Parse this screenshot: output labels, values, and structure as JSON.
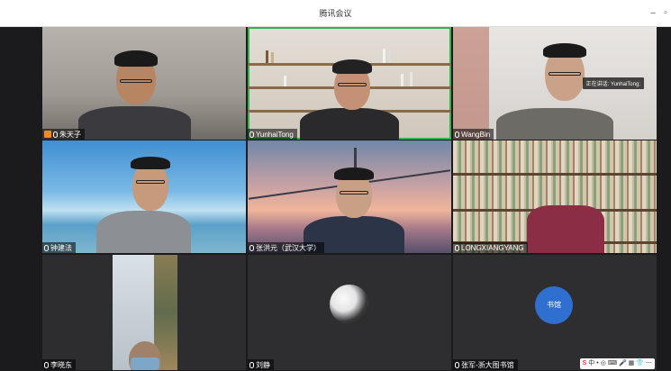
{
  "window": {
    "title": "腾讯会议",
    "minimize_label": "–",
    "restore_label": "▫"
  },
  "speaking_badge": "正在讲话: YunhaiTong;",
  "participants": [
    {
      "name": "朱天子",
      "host": true
    },
    {
      "name": "YunhaiTong",
      "active": true
    },
    {
      "name": "WangBin"
    },
    {
      "name": "钟建法"
    },
    {
      "name": "张洪元（武汉大学）"
    },
    {
      "name": "LONGXIANGYANG"
    },
    {
      "name": "李晓东"
    },
    {
      "name": "刘静"
    },
    {
      "name": "张军-浙大图书馆",
      "avatar_text": "书馆"
    }
  ],
  "tray": {
    "icons": [
      "sogou-s-icon",
      "zh-mode-icon",
      "punctuation-icon",
      "emoji-icon",
      "keyboard-icon",
      "mic-icon",
      "grid-icon",
      "shirt-icon",
      "apps-icon"
    ],
    "glyphs": [
      "S",
      "中",
      "•",
      "◎",
      "⌨",
      "🎤",
      "▦",
      "👕",
      "⋯"
    ]
  },
  "colors": {
    "active_outline": "#2fb54c",
    "avatar_blue": "#2f6fd0",
    "host_badge": "#f08a24"
  }
}
